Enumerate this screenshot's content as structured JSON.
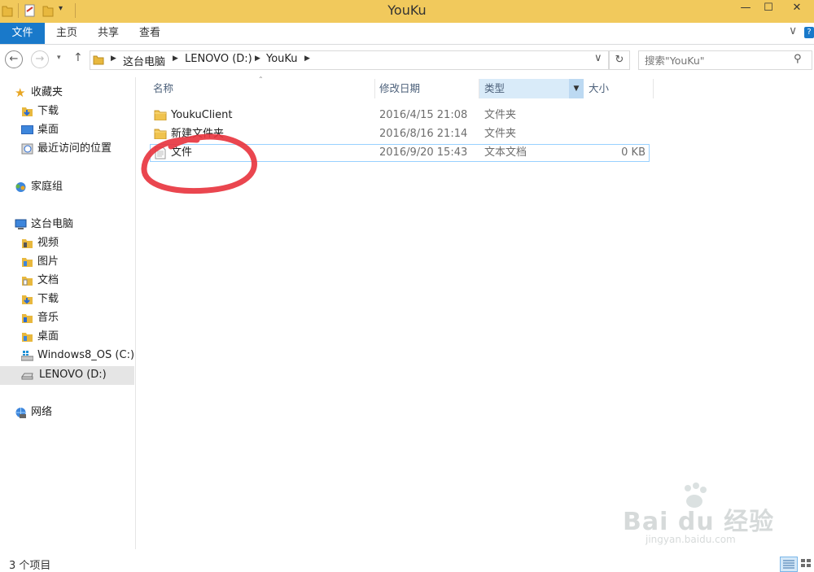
{
  "window": {
    "title": "YouKu"
  },
  "ribbon": {
    "tabs": [
      "文件",
      "主页",
      "共享",
      "查看"
    ]
  },
  "address": {
    "crumbs": [
      "这台电脑",
      "LENOVO (D:)",
      "YouKu"
    ]
  },
  "search": {
    "placeholder": "搜索\"YouKu\""
  },
  "sidebar": {
    "favorites_label": "收藏夹",
    "favorites": [
      "下载",
      "桌面",
      "最近访问的位置"
    ],
    "homegroup_label": "家庭组",
    "thispc_label": "这台电脑",
    "thispc": [
      "视频",
      "图片",
      "文档",
      "下载",
      "音乐",
      "桌面",
      "Windows8_OS (C:)",
      "LENOVO (D:)"
    ],
    "network_label": "网络"
  },
  "columns": {
    "name": "名称",
    "date": "修改日期",
    "type": "类型",
    "size": "大小"
  },
  "files": [
    {
      "name": "YoukuClient",
      "date": "2016/4/15 21:08",
      "type": "文件夹",
      "size": ""
    },
    {
      "name": "新建文件夹",
      "date": "2016/8/16 21:14",
      "type": "文件夹",
      "size": ""
    },
    {
      "name": "文件",
      "date": "2016/9/20 15:43",
      "type": "文本文档",
      "size": "0 KB"
    }
  ],
  "status": {
    "count": "3 个项目"
  },
  "watermark": {
    "brand": "Bai du 经验",
    "url": "jingyan.baidu.com"
  },
  "colors": {
    "titlebar": "#f1c95c",
    "file_tab": "#1979ca",
    "selection": "#cce8ff",
    "annotation": "#e8323c"
  }
}
